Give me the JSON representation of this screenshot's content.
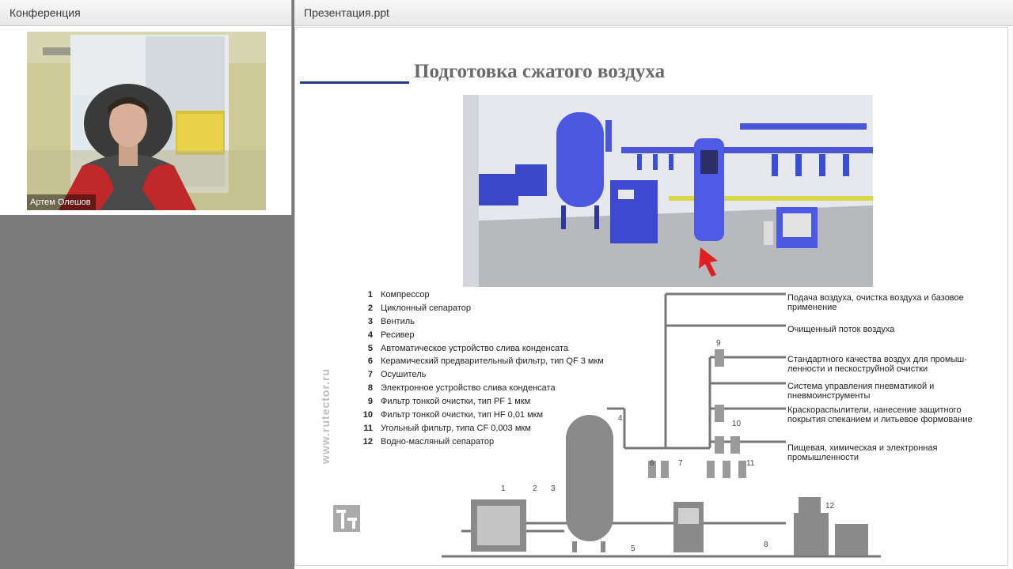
{
  "conference": {
    "title": "Конференция",
    "participant_name": "Артем Олешов"
  },
  "presentation": {
    "title": "Презентация.ppt",
    "slide_title": "Подготовка сжатого воздуха",
    "legend": [
      {
        "num": "1",
        "text": "Компрессор"
      },
      {
        "num": "2",
        "text": "Циклонный сепаратор"
      },
      {
        "num": "3",
        "text": "Вентиль"
      },
      {
        "num": "4",
        "text": "Ресивер"
      },
      {
        "num": "5",
        "text": "Автоматическое устройство слива конденсата"
      },
      {
        "num": "6",
        "text": "Керамический предварительный фильтр, тип   QF 3 мкм"
      },
      {
        "num": "7",
        "text": "Осушитель"
      },
      {
        "num": "8",
        "text": "Электронное устройство слива конденсата"
      },
      {
        "num": "9",
        "text": "Фильтр тонкой очистки, тип   PF 1 мкм"
      },
      {
        "num": "10",
        "text": "Фильтр тонкой очистки, тип   HF 0,01 мкм"
      },
      {
        "num": "11",
        "text": "Угольный фильтр, типа   CF 0,003 мкм"
      },
      {
        "num": "12",
        "text": "Водно-масляный сепаратор"
      }
    ],
    "applications": [
      {
        "text": "Подача воздуха, очистка воздуха и базовое применение"
      },
      {
        "text": "Очищенный поток воздуха"
      },
      {
        "text": "Стандартного качества воздух для промыш-ленности и пескоструйной очистки"
      },
      {
        "text": "Система управления пневматикой и пневмоинструменты"
      },
      {
        "text": "Краскораспылители, нанесение защитного покрытия спеканием и литьевое формование"
      },
      {
        "text": "Пищевая, химическая и электронная промышленности"
      }
    ],
    "watermark": "www.rutector.ru",
    "diagram_numbers": [
      "1",
      "2",
      "3",
      "4",
      "5",
      "6",
      "7",
      "8",
      "9",
      "10",
      "11",
      "12"
    ]
  },
  "colors": {
    "header_bg": "#eeeeee",
    "slide_accent": "#1f3c8f",
    "equipment_blue": "#3a4fd6",
    "background": "#7b7b7b"
  }
}
